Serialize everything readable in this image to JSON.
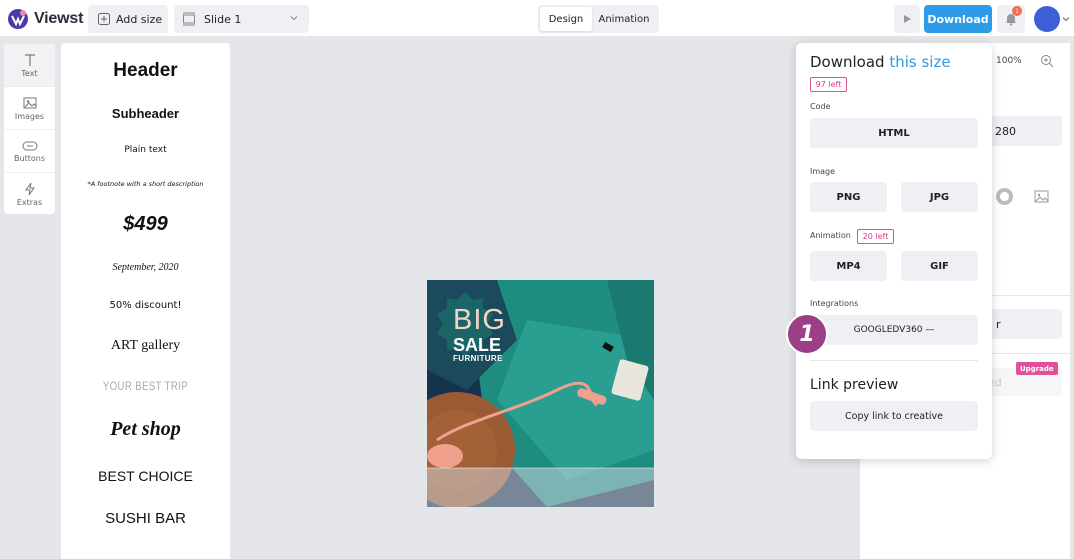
{
  "app": {
    "name": "Viewst"
  },
  "topbar": {
    "add_size": "Add size",
    "slide": "Slide 1",
    "tab_design": "Design",
    "tab_animation": "Animation",
    "download": "Download",
    "notification_count": "1"
  },
  "toolrail": {
    "items": [
      {
        "label": "Text"
      },
      {
        "label": "Images"
      },
      {
        "label": "Buttons"
      },
      {
        "label": "Extras"
      }
    ]
  },
  "text_presets": [
    "Header",
    "Subheader",
    "Plain text",
    "*A footnote with a short description",
    "$499",
    "September, 2020",
    "50% discount!",
    "ART gallery",
    "YOUR BEST TRIP",
    "Pet shop",
    "BEST CHOICE",
    "SUSHI BAR"
  ],
  "canvas": {
    "big": "BIG",
    "sale": "SALE",
    "furniture": "FURNITURE"
  },
  "right_panel": {
    "zoom": "100%",
    "field_value": "280",
    "upgrade": "Upgrade",
    "faded": "ed",
    "r_char": "r"
  },
  "download_menu": {
    "title_prefix": "Download",
    "title_highlight": "this size",
    "left_badge": "97 left",
    "code_label": "Code",
    "html": "HTML",
    "image_label": "Image",
    "png": "PNG",
    "jpg": "JPG",
    "animation_label": "Animation",
    "animation_badge": "20 left",
    "mp4": "MP4",
    "gif": "GIF",
    "integrations_label": "Integrations",
    "googledv360": "GOOGLEDV360 —",
    "link_preview": "Link preview",
    "copy_link": "Copy link to creative"
  },
  "step_marker": "1",
  "colors": {
    "accent": "#2d9be8",
    "badge": "#e0519a",
    "step": "#9c3f87",
    "canvas_sofa": "#1e8a7e"
  }
}
